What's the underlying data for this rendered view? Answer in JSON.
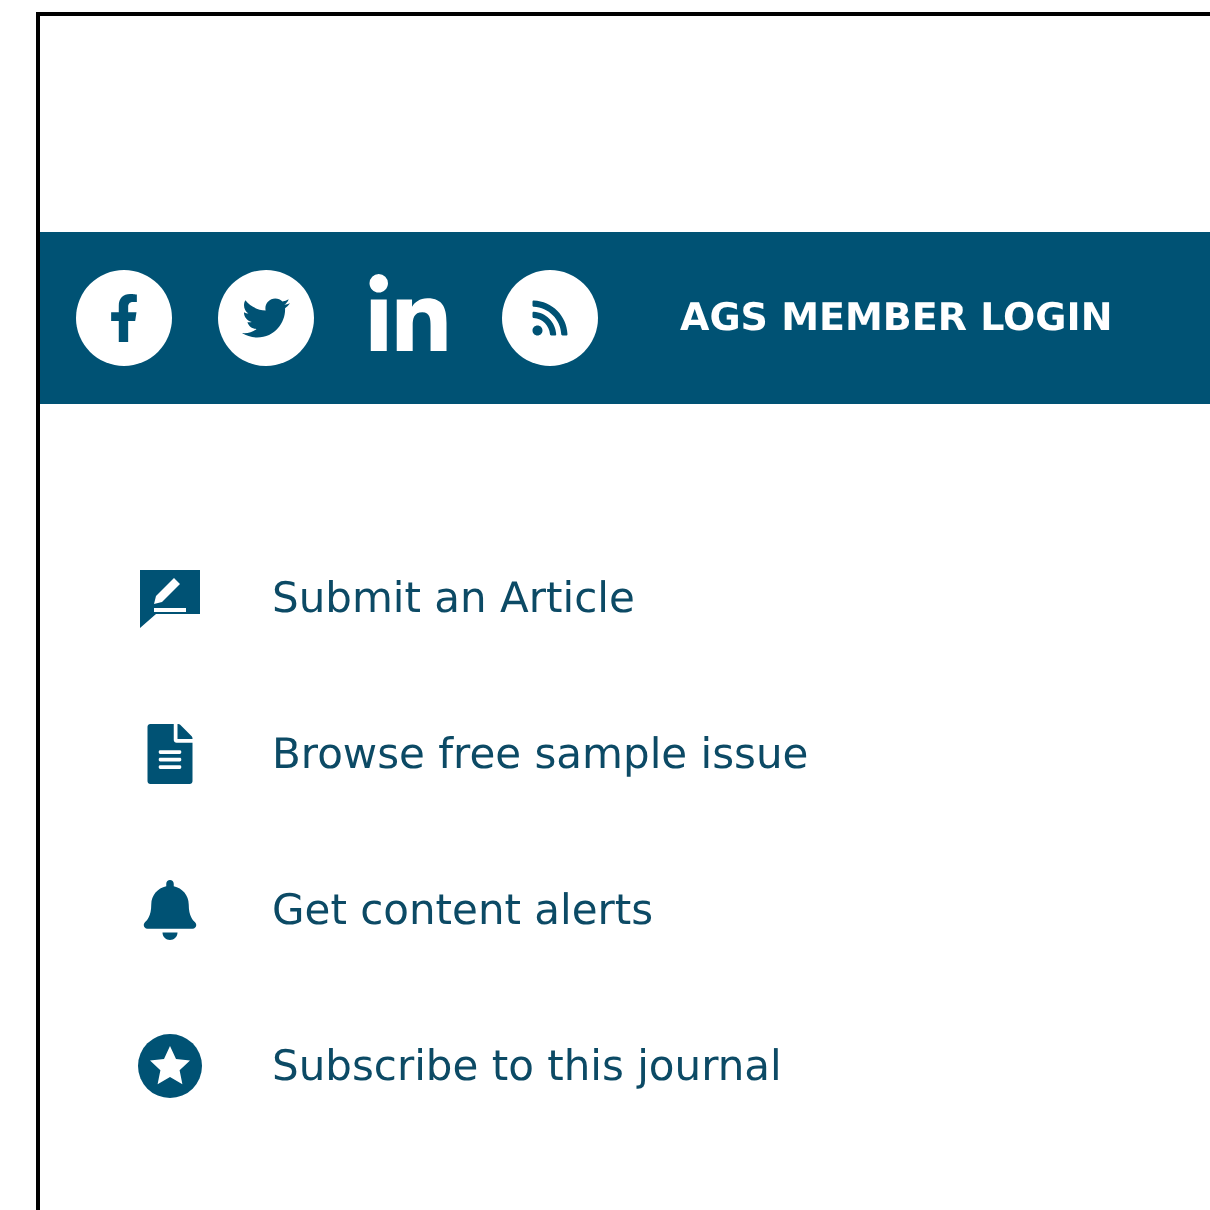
{
  "social_bar": {
    "icons": [
      {
        "kind": "facebook"
      },
      {
        "kind": "twitter"
      },
      {
        "kind": "linkedin"
      },
      {
        "kind": "rss"
      }
    ],
    "login": "AGS MEMBER LOGIN"
  },
  "links": [
    {
      "kind": "submit",
      "label": "Submit an Article"
    },
    {
      "kind": "document",
      "label": "Browse free sample issue"
    },
    {
      "kind": "bell",
      "label": "Get content alerts"
    },
    {
      "kind": "star",
      "label": "Subscribe to this journal"
    }
  ]
}
